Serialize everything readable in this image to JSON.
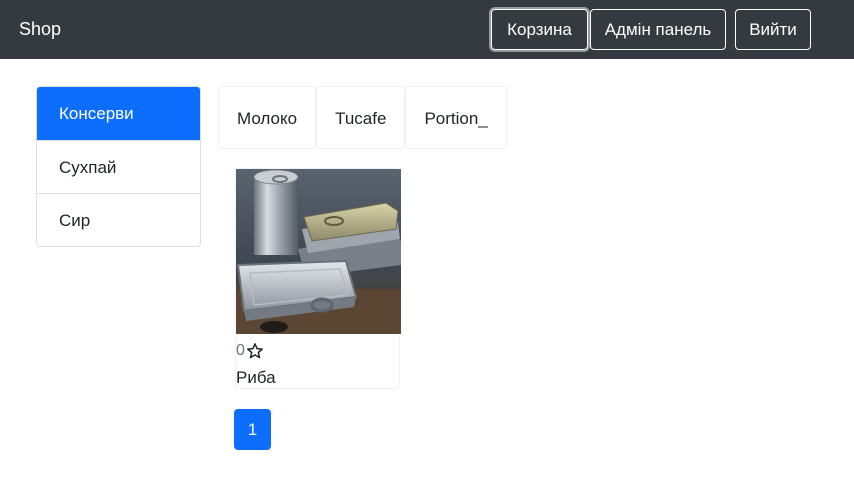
{
  "navbar": {
    "brand": "Shop",
    "cart_label": "Корзина",
    "admin_label": "Адмін панель",
    "logout_label": "Вийти"
  },
  "types": [
    {
      "label": "Консерви",
      "active": true
    },
    {
      "label": "Сухпай",
      "active": false
    },
    {
      "label": "Сир",
      "active": false
    }
  ],
  "brands": [
    {
      "label": "Молоко"
    },
    {
      "label": "Tucafe"
    },
    {
      "label": "Portion_"
    }
  ],
  "devices": [
    {
      "rating": "0",
      "name": "Риба",
      "image": "canned-food-tins"
    }
  ],
  "pagination": {
    "pages": [
      "1"
    ],
    "active": "1"
  },
  "colors": {
    "navbar_bg": "#343a40",
    "primary": "#0d6efd"
  }
}
